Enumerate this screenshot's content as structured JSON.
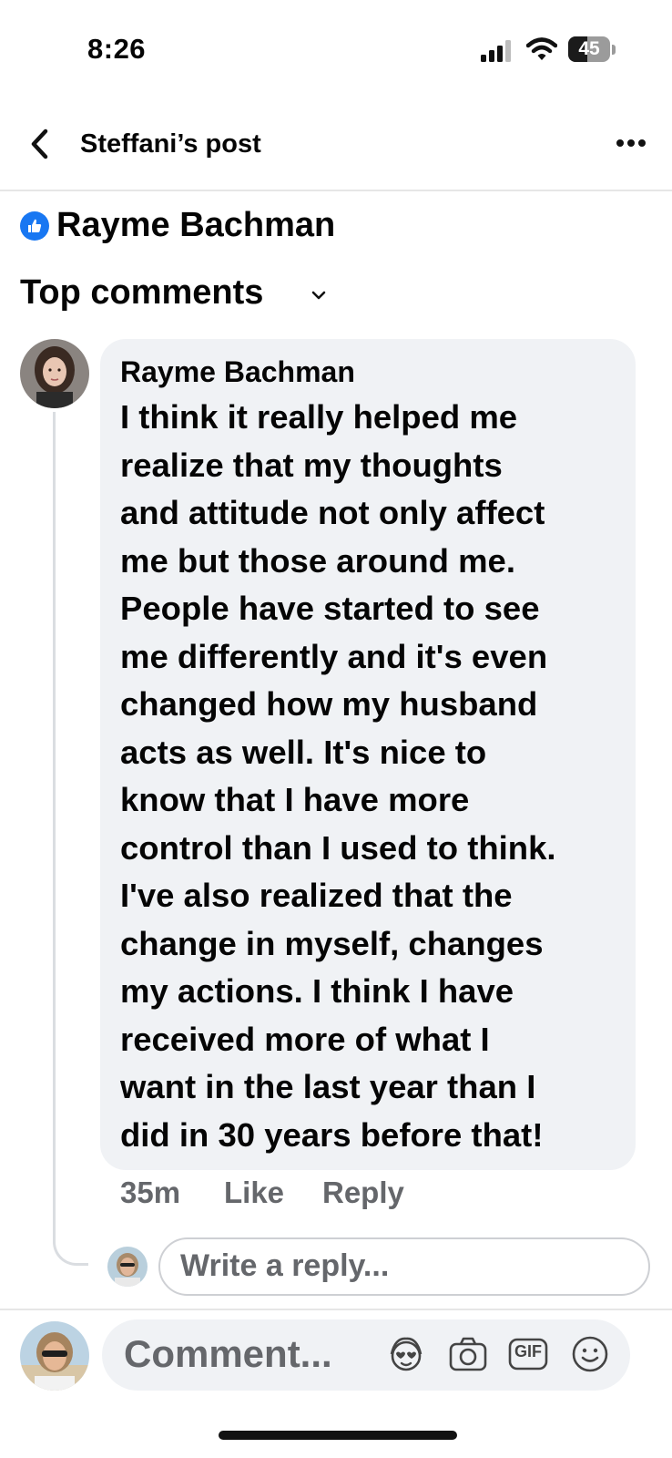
{
  "status_bar": {
    "time": "8:26",
    "battery": "45",
    "battery_level": 0.45
  },
  "header": {
    "title": "Steffani’s post"
  },
  "reaction_line": {
    "name": "Rayme Bachman"
  },
  "comments_filter": {
    "label": "Top comments"
  },
  "comment": {
    "author": "Rayme Bachman",
    "lines": [
      "I think it really helped me",
      "realize that my thoughts",
      "and attitude not only affect",
      "me but those around me.",
      "People have started to see",
      "me differently and it's even",
      "changed how my husband",
      "acts as well. It's nice to",
      "know that I have more",
      "control than I used to think.",
      "I've also realized that the",
      "change in myself, changes",
      "my actions. I think I have",
      "received more of what I",
      "want in the last year than I",
      "did in 30 years before that!"
    ],
    "time": "35m",
    "like_label": "Like",
    "reply_label": "Reply"
  },
  "reply_box": {
    "placeholder": "Write a reply..."
  },
  "composer": {
    "placeholder": "Comment...",
    "gif_label": "GIF",
    "icons": [
      "avatar-sticker-icon",
      "camera-icon",
      "gif-icon",
      "emoji-icon"
    ]
  },
  "colors": {
    "accent": "#1877f2",
    "bubble": "#f0f2f5",
    "muted": "#65676b"
  }
}
